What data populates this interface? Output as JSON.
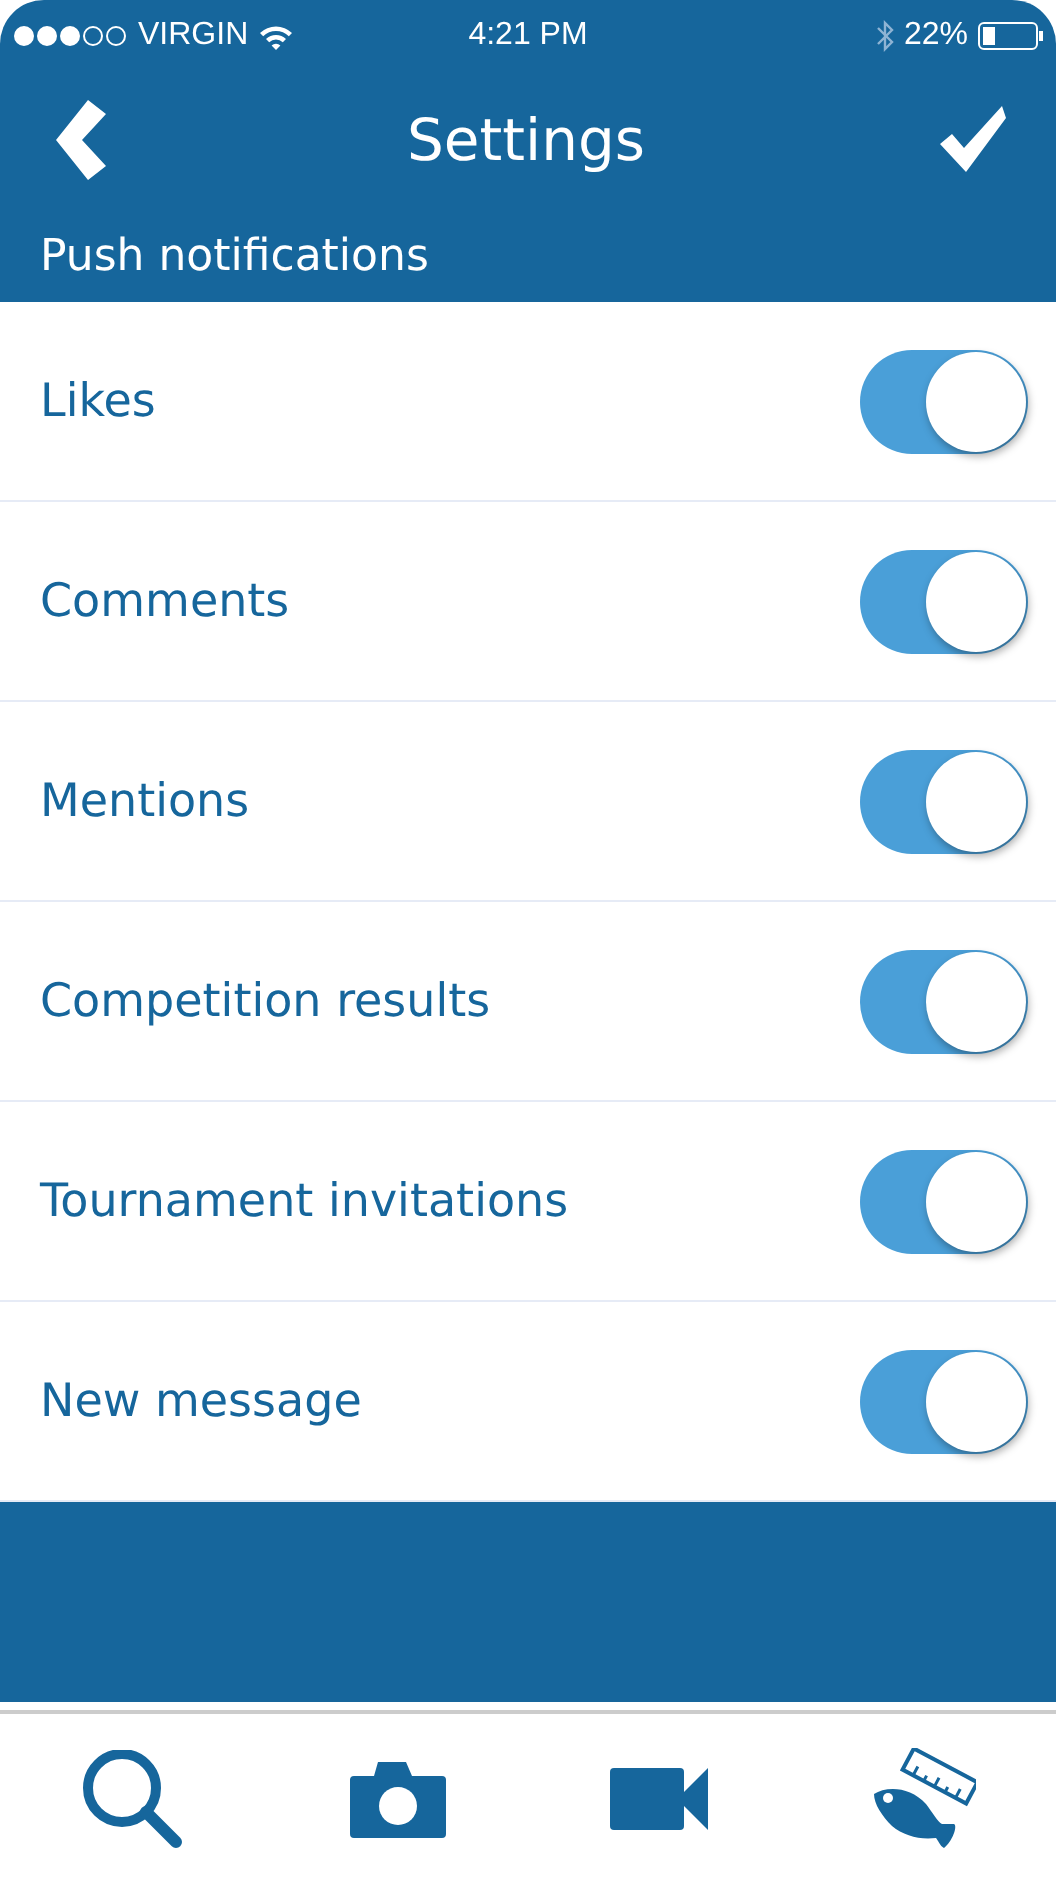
{
  "status_bar": {
    "carrier": "VIRGIN",
    "time": "4:21 PM",
    "battery": "22%"
  },
  "nav": {
    "title": "Settings"
  },
  "section": {
    "title": "Push notifications"
  },
  "settings": [
    {
      "label": "Likes",
      "on": true
    },
    {
      "label": "Comments",
      "on": true
    },
    {
      "label": "Mentions",
      "on": true
    },
    {
      "label": "Competition results",
      "on": true
    },
    {
      "label": "Tournament invitations",
      "on": true
    },
    {
      "label": "New message",
      "on": true
    }
  ],
  "tab_bar": [
    {
      "kind": "search"
    },
    {
      "kind": "camera"
    },
    {
      "kind": "video"
    },
    {
      "kind": "fish"
    }
  ]
}
